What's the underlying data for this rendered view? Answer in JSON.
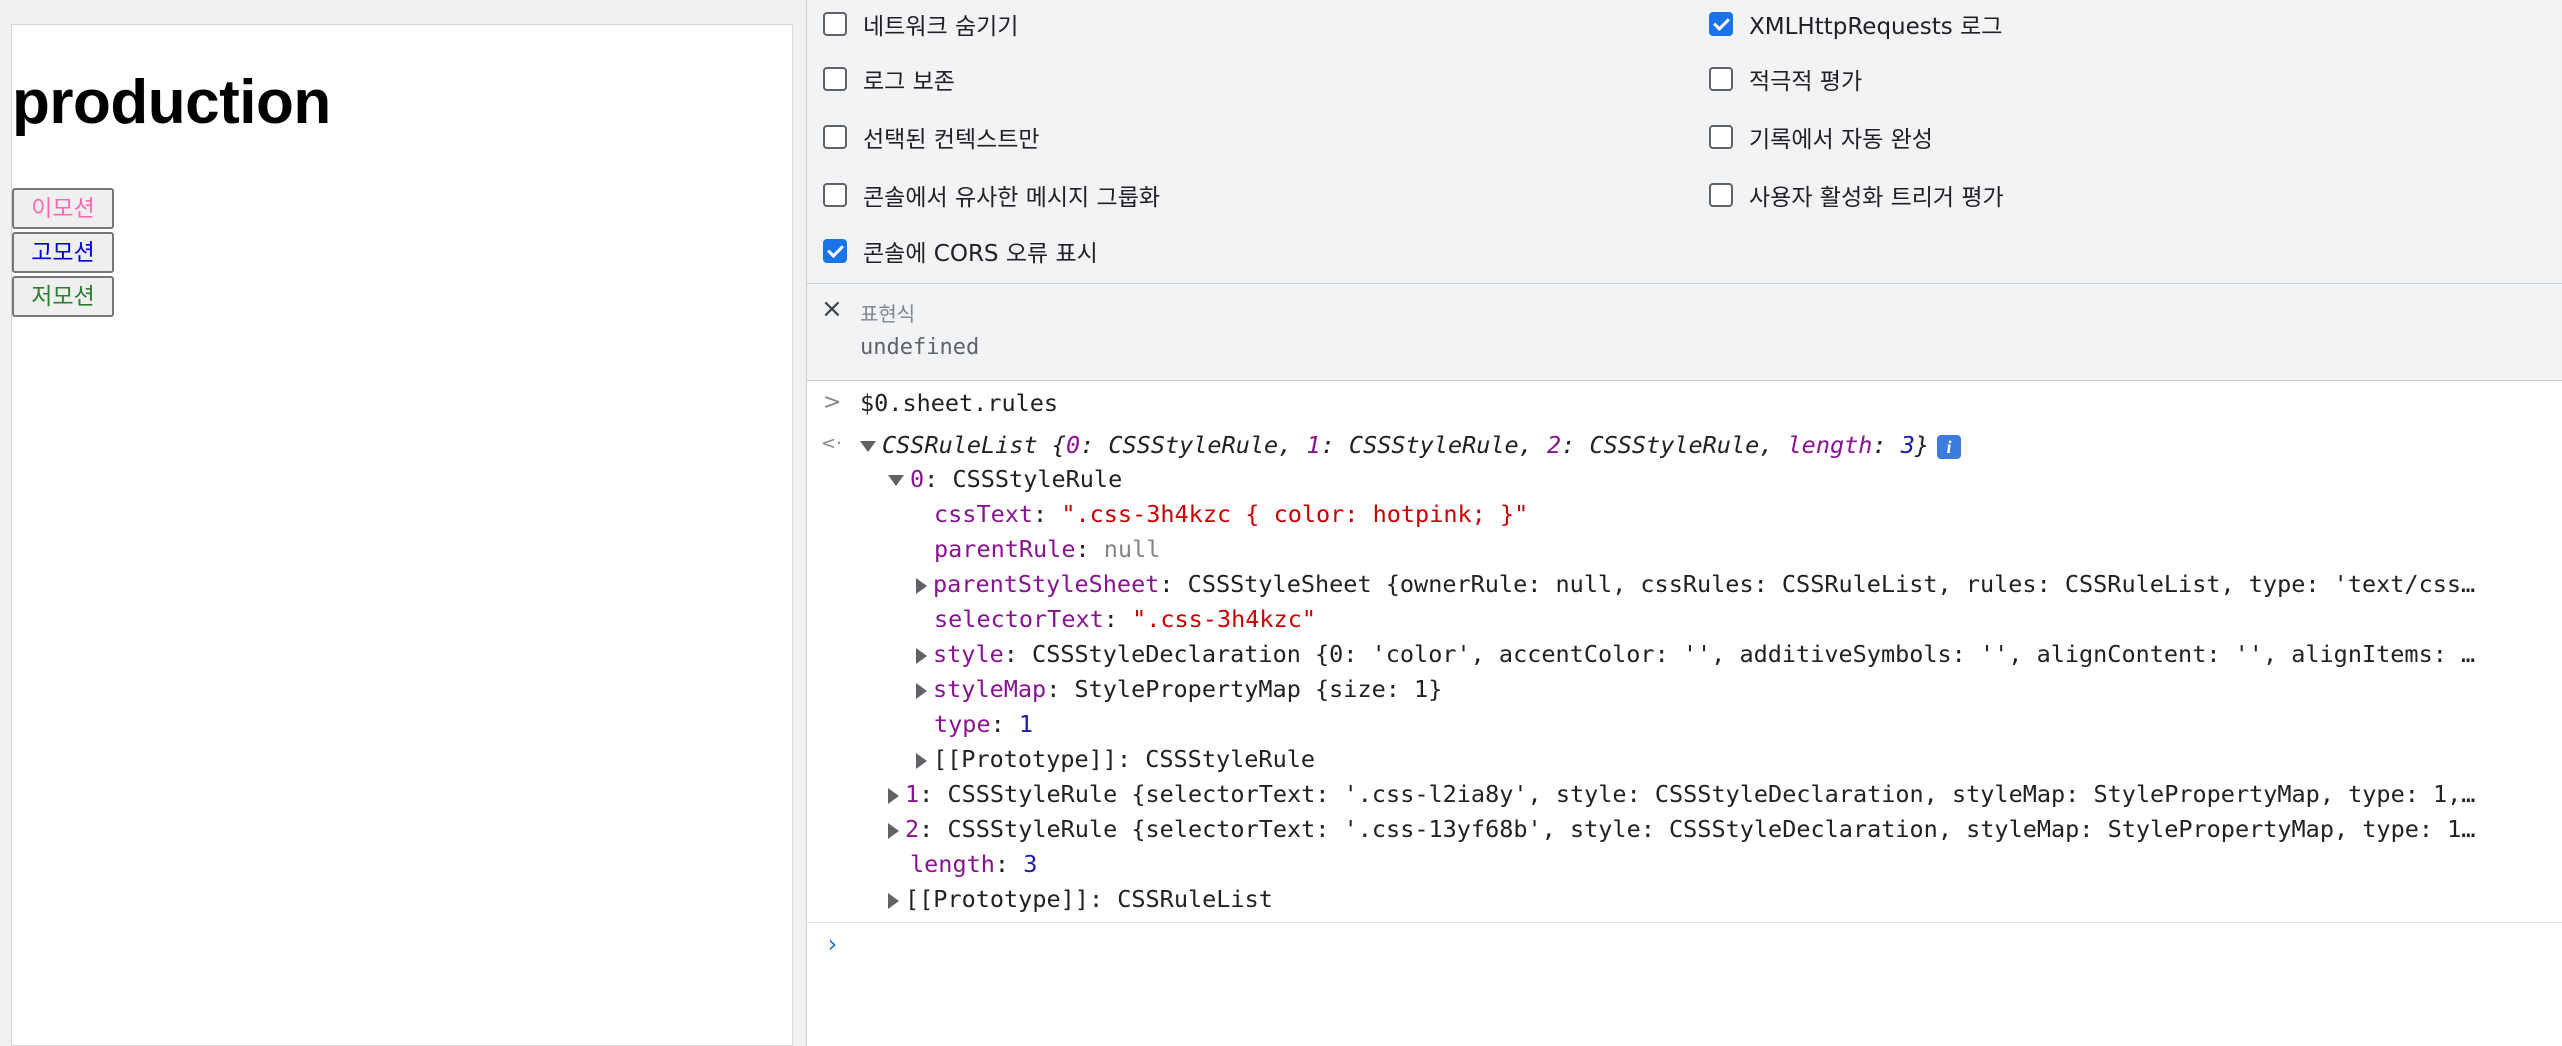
{
  "page": {
    "title": "production",
    "buttons": [
      {
        "label": "이모션",
        "color": "#ff69b4"
      },
      {
        "label": "고모션",
        "color": "#0000cc"
      },
      {
        "label": "저모션",
        "color": "#2e7d32"
      }
    ]
  },
  "console_settings": {
    "left": [
      {
        "label": "네트워크 숨기기",
        "checked": false
      },
      {
        "label": "로그 보존",
        "checked": false
      },
      {
        "label": "선택된 컨텍스트만",
        "checked": false
      },
      {
        "label": "콘솔에서 유사한 메시지 그룹화",
        "checked": false
      },
      {
        "label": "콘솔에 CORS 오류 표시",
        "checked": true
      }
    ],
    "right": [
      {
        "label": "XMLHttpRequests 로그",
        "checked": true
      },
      {
        "label": "적극적 평가",
        "checked": false
      },
      {
        "label": "기록에서 자동 완성",
        "checked": false
      },
      {
        "label": "사용자 활성화 트리거 평가",
        "checked": false
      }
    ]
  },
  "live_expression": {
    "close_icon": "×",
    "label": "표현식",
    "value": "undefined"
  },
  "console": {
    "input_prompt": ">",
    "result_prompt": "<·",
    "command": "$0.sheet.rules",
    "summary": {
      "type": "CSSRuleList",
      "open": " {",
      "items": [
        {
          "key": "0",
          "value": "CSSStyleRule"
        },
        {
          "key": "1",
          "value": "CSSStyleRule"
        },
        {
          "key": "2",
          "value": "CSSStyleRule"
        }
      ],
      "length_key": "length",
      "length_value": "3",
      "close": "}"
    },
    "rule0": {
      "key": "0",
      "type": "CSSStyleRule",
      "cssText_key": "cssText",
      "cssText_value": "\".css-3h4kzc { color: hotpink; }\"",
      "parentRule_key": "parentRule",
      "parentRule_value": "null",
      "parentStyleSheet_key": "parentStyleSheet",
      "parentStyleSheet_value": "CSSStyleSheet {ownerRule: null, cssRules: CSSRuleList, rules: CSSRuleList, type: 'text/css…",
      "selectorText_key": "selectorText",
      "selectorText_value": "\".css-3h4kzc\"",
      "style_key": "style",
      "style_value": "CSSStyleDeclaration {0: 'color', accentColor: '', additiveSymbols: '', alignContent: '', alignItems: …",
      "styleMap_key": "styleMap",
      "styleMap_value": "StylePropertyMap {size: 1}",
      "type_key": "type",
      "type_value": "1",
      "proto_key": "[[Prototype]]",
      "proto_value": "CSSStyleRule"
    },
    "rule1": {
      "key": "1",
      "value": "CSSStyleRule {selectorText: '.css-l2ia8y', style: CSSStyleDeclaration, styleMap: StylePropertyMap, type: 1,…"
    },
    "rule2": {
      "key": "2",
      "value": "CSSStyleRule {selectorText: '.css-13yf68b', style: CSSStyleDeclaration, styleMap: StylePropertyMap, type: 1…"
    },
    "length_key": "length",
    "length_value": "3",
    "list_proto_key": "[[Prototype]]",
    "list_proto_value": "CSSRuleList",
    "info_icon": "i",
    "input_chevron": "›"
  },
  "colors": {
    "accent": "#1a73e8",
    "key": "#881391",
    "string": "#c80000",
    "number": "#1a1aa6",
    "null": "#80868b"
  }
}
